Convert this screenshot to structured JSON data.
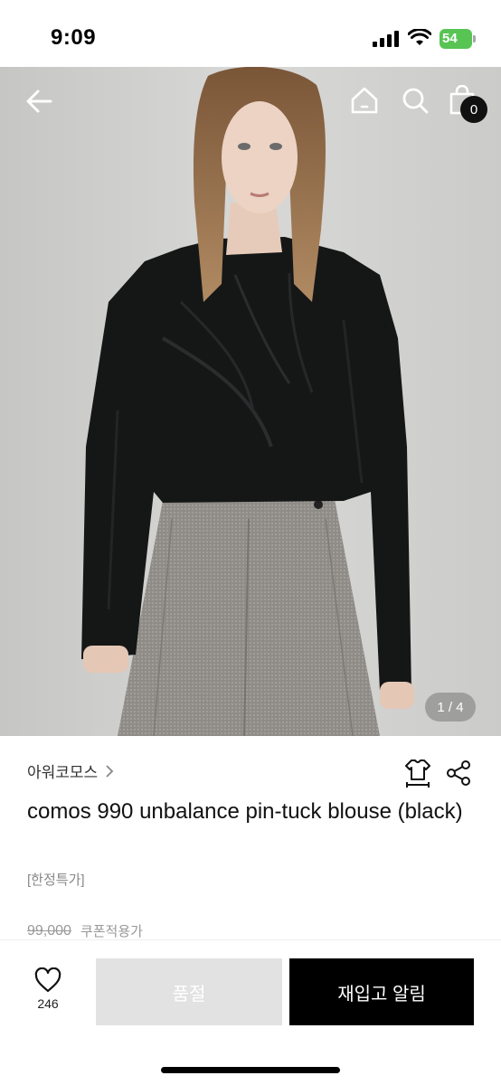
{
  "status_bar": {
    "time": "9:09",
    "battery_level": "54",
    "battery_color": "#58c454"
  },
  "nav": {
    "back_icon": "arrow-left-icon",
    "home_icon": "home-icon",
    "search_icon": "search-icon",
    "cart_icon": "shopping-bag-icon",
    "cart_count": "0"
  },
  "gallery": {
    "pager": "1 / 4",
    "current_index": 1,
    "total": 4
  },
  "product": {
    "brand": "아워코모스",
    "title": "comos 990 unbalance pin-tuck blouse (black)",
    "tag": "[한정특가]",
    "original_price": "99,000",
    "coupon_label": "쿠폰적용가"
  },
  "actions": {
    "like_count": "246",
    "soldout_label": "품절",
    "restock_label": "재입고 알림",
    "fit_icon": "size-guide-icon",
    "share_icon": "share-icon"
  }
}
